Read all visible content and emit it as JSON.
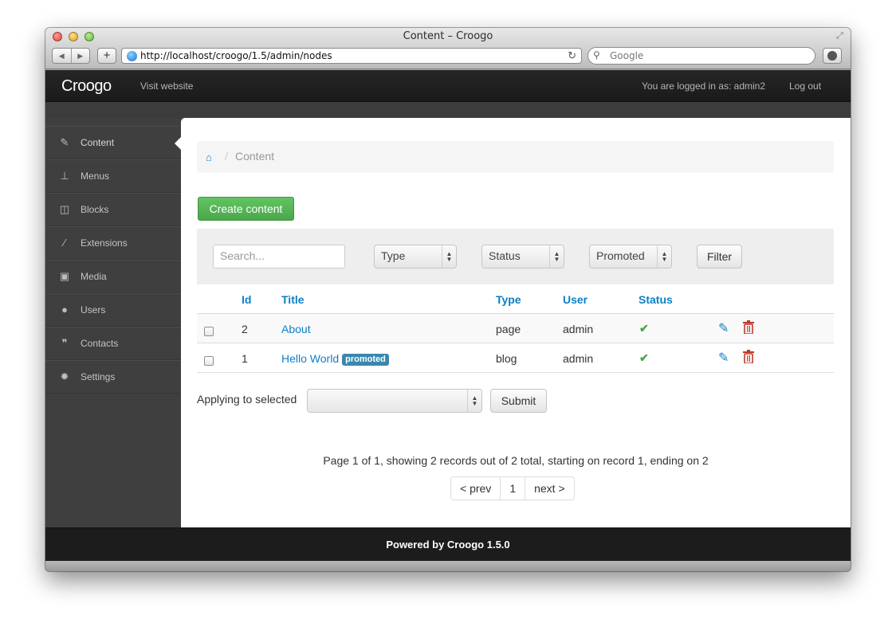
{
  "browser": {
    "window_title": "Content – Croogo",
    "url": "http://localhost/croogo/1.5/admin/nodes",
    "search_placeholder": "Google"
  },
  "topnav": {
    "brand": "Croogo",
    "visit_link": "Visit website",
    "logged_in_text": "You are logged in as: admin2",
    "logout": "Log out"
  },
  "sidebar": {
    "items": [
      {
        "label": "Content",
        "icon": "edit-icon"
      },
      {
        "label": "Menus",
        "icon": "sitemap-icon"
      },
      {
        "label": "Blocks",
        "icon": "columns-icon"
      },
      {
        "label": "Extensions",
        "icon": "magic-wand-icon"
      },
      {
        "label": "Media",
        "icon": "picture-icon"
      },
      {
        "label": "Users",
        "icon": "user-icon"
      },
      {
        "label": "Contacts",
        "icon": "comments-icon"
      },
      {
        "label": "Settings",
        "icon": "gear-icon"
      }
    ]
  },
  "breadcrumb": {
    "current": "Content",
    "separator": "/"
  },
  "actions": {
    "create": "Create content"
  },
  "filter": {
    "search_placeholder": "Search...",
    "type": "Type",
    "status": "Status",
    "promoted": "Promoted",
    "button": "Filter"
  },
  "table": {
    "headers": {
      "id": "Id",
      "title": "Title",
      "type": "Type",
      "user": "User",
      "status": "Status"
    },
    "rows": [
      {
        "id": "2",
        "title": "About",
        "type": "page",
        "user": "admin",
        "badge": ""
      },
      {
        "id": "1",
        "title": "Hello World",
        "type": "blog",
        "user": "admin",
        "badge": "promoted"
      }
    ]
  },
  "bulk": {
    "label": "Applying to selected",
    "submit": "Submit"
  },
  "pagination": {
    "info": "Page 1 of 1, showing 2 records out of 2 total, starting on record 1, ending on 2",
    "prev": "< prev",
    "current": "1",
    "next": "next >"
  },
  "footer": {
    "text": "Powered by Croogo 1.5.0"
  },
  "colors": {
    "link": "#0d7fc4",
    "success": "#46a546",
    "danger": "#c0392b",
    "badge": "#3a87ad"
  }
}
